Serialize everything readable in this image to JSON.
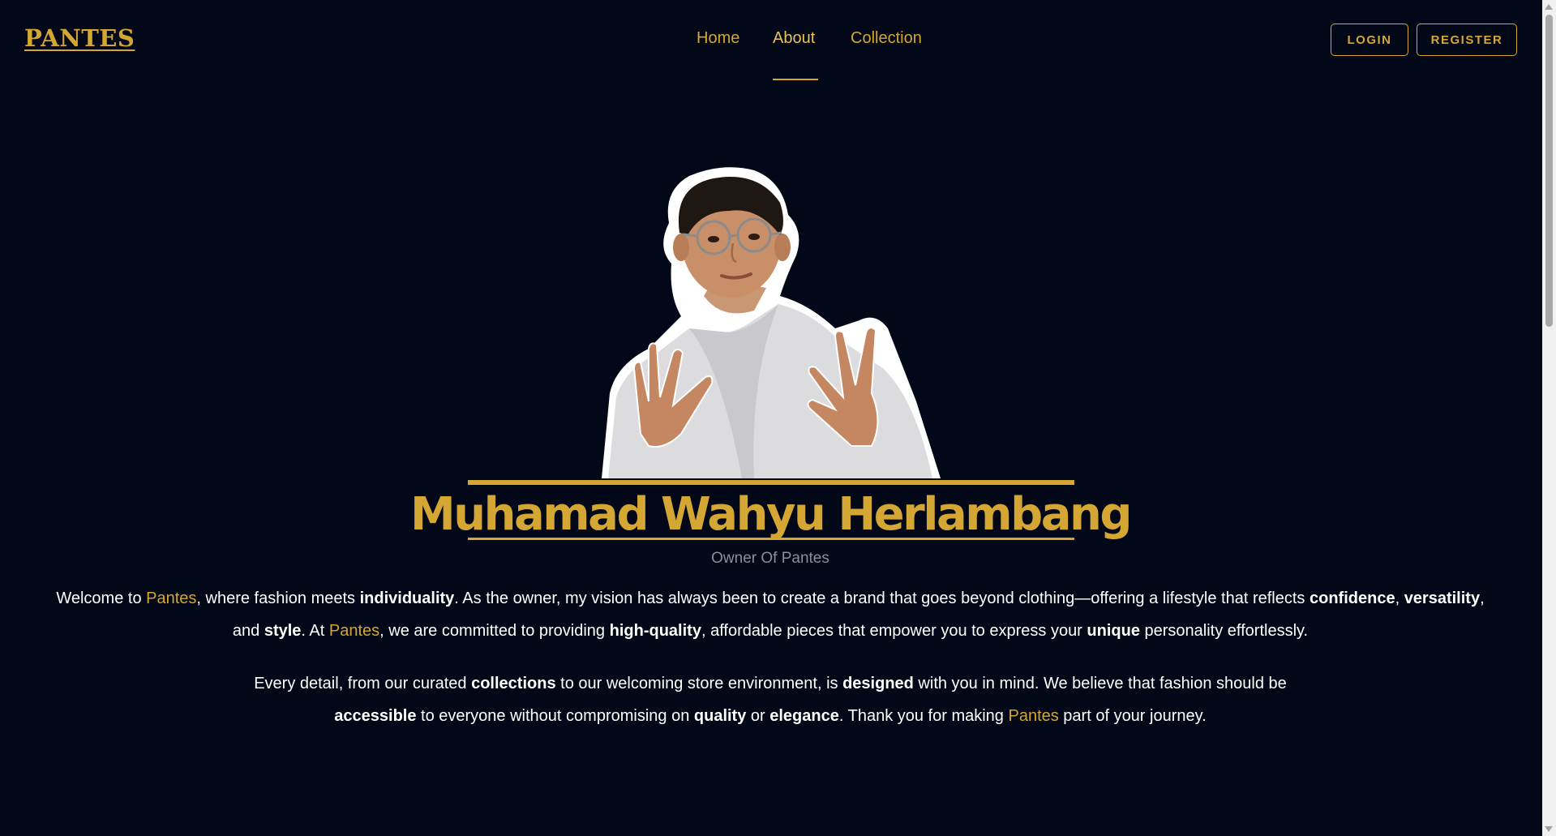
{
  "header": {
    "logo": "PANTES",
    "nav": [
      {
        "label": "Home"
      },
      {
        "label": "About"
      },
      {
        "label": "Collection"
      }
    ],
    "active_nav": "About",
    "login_label": "LOGIN",
    "register_label": "REGISTER"
  },
  "profile": {
    "name": "Muhamad Wahyu Herlambang",
    "role": "Owner Of Pantes"
  },
  "about": {
    "p1": [
      {
        "t": "Welcome to "
      },
      {
        "t": "Pantes",
        "hl": true
      },
      {
        "t": ", where fashion meets "
      },
      {
        "t": "individuality",
        "b": true
      },
      {
        "t": ". As the owner, my vision has always been to create a brand that goes beyond clothing—offering a lifestyle that reflects "
      },
      {
        "t": "confidence",
        "b": true
      },
      {
        "t": ", "
      },
      {
        "t": "versatility",
        "b": true
      },
      {
        "t": ", and "
      },
      {
        "t": "style",
        "b": true
      },
      {
        "t": ". At "
      },
      {
        "t": "Pantes",
        "hl": true
      },
      {
        "t": ", we are committed to providing "
      },
      {
        "t": "high-quality",
        "b": true
      },
      {
        "t": ", affordable pieces that empower you to express your "
      },
      {
        "t": "unique",
        "b": true
      },
      {
        "t": " personality effortlessly."
      }
    ],
    "p2": [
      {
        "t": "Every detail, from our curated "
      },
      {
        "t": "collections",
        "b": true
      },
      {
        "t": " to our welcoming store environment, is "
      },
      {
        "t": "designed",
        "b": true
      },
      {
        "t": " with you in mind. We believe that fashion should be "
      },
      {
        "t": "accessible",
        "b": true
      },
      {
        "t": " to everyone without compromising on "
      },
      {
        "t": "quality",
        "b": true
      },
      {
        "t": " or "
      },
      {
        "t": "elegance",
        "b": true
      },
      {
        "t": ". Thank you for making "
      },
      {
        "t": "Pantes",
        "hl": true
      },
      {
        "t": " part of your journey."
      }
    ]
  },
  "colors": {
    "background": "#020817",
    "accent": "#d4a633",
    "muted": "#8a8f9c",
    "text": "#ffffff"
  },
  "icons": {
    "portrait": "owner-photo-illustration",
    "scroll_up": "triangle-up-icon",
    "scroll_down": "triangle-down-icon"
  }
}
